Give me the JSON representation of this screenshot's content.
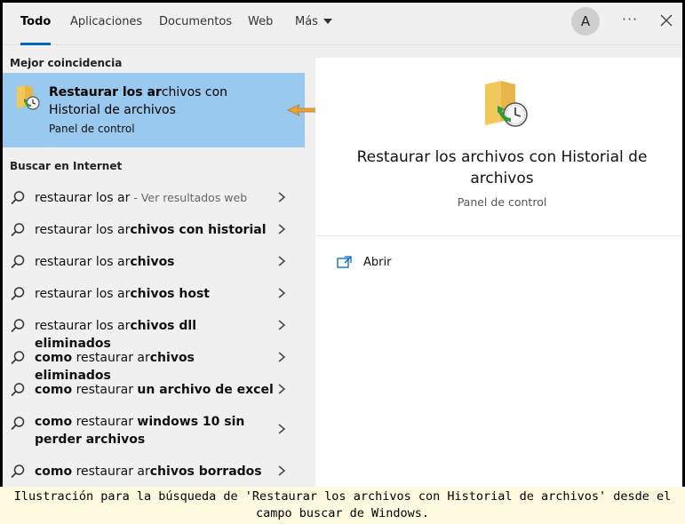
{
  "tabs": [
    {
      "label": "Todo"
    },
    {
      "label": "Aplicaciones"
    },
    {
      "label": "Documentos"
    },
    {
      "label": "Web"
    },
    {
      "label": "Más"
    }
  ],
  "header": {
    "avatar_letter": "A",
    "more_label": "···"
  },
  "left": {
    "best_match_title": "Mejor coincidencia",
    "best_match": {
      "title_bold": "Restaurar los ar",
      "title_rest": "chivos con Historial de archivos",
      "subtitle": "Panel de control",
      "icon": "file-history-folder-icon"
    },
    "web_title": "Buscar en Internet",
    "suggestions": [
      {
        "parts": [
          {
            "t": "restaurar los ar",
            "s": "n"
          },
          {
            "t": " - Ver resultados web",
            "s": "h"
          }
        ]
      },
      {
        "parts": [
          {
            "t": "restaurar los ar",
            "s": "n"
          },
          {
            "t": "chivos con historial",
            "s": "b"
          }
        ]
      },
      {
        "parts": [
          {
            "t": "restaurar los ar",
            "s": "n"
          },
          {
            "t": "chivos",
            "s": "b"
          }
        ]
      },
      {
        "parts": [
          {
            "t": "restaurar los ar",
            "s": "n"
          },
          {
            "t": "chivos host",
            "s": "b"
          }
        ]
      },
      {
        "parts": [
          {
            "t": "restaurar los ar",
            "s": "n"
          },
          {
            "t": "chivos dll eliminados",
            "s": "b"
          }
        ]
      },
      {
        "parts": [
          {
            "t": "como",
            "s": "b"
          },
          {
            "t": " restaurar ar",
            "s": "n"
          },
          {
            "t": "chivos eliminados",
            "s": "b"
          }
        ]
      },
      {
        "parts": [
          {
            "t": "como",
            "s": "b"
          },
          {
            "t": " restaurar ",
            "s": "n"
          },
          {
            "t": "un archivo de excel",
            "s": "b"
          }
        ]
      },
      {
        "parts": [
          {
            "t": "como",
            "s": "b"
          },
          {
            "t": " restaurar ",
            "s": "n"
          },
          {
            "t": "windows 10 sin perder archivos",
            "s": "b"
          }
        ],
        "tall": true
      },
      {
        "parts": [
          {
            "t": "como",
            "s": "b"
          },
          {
            "t": " restaurar ar",
            "s": "n"
          },
          {
            "t": "chivos borrados",
            "s": "b"
          }
        ]
      }
    ]
  },
  "right": {
    "title": "Restaurar los archivos con Historial de archivos",
    "subtitle": "Panel de control",
    "open_label": "Abrir"
  },
  "caption": "Ilustración para la búsqueda de 'Restaurar los archivos con Historial de archivos' desde el campo buscar de Windows.",
  "colors": {
    "accent": "#0067c0",
    "selection": "#99c9ef",
    "arrow": "#e8a33a"
  }
}
